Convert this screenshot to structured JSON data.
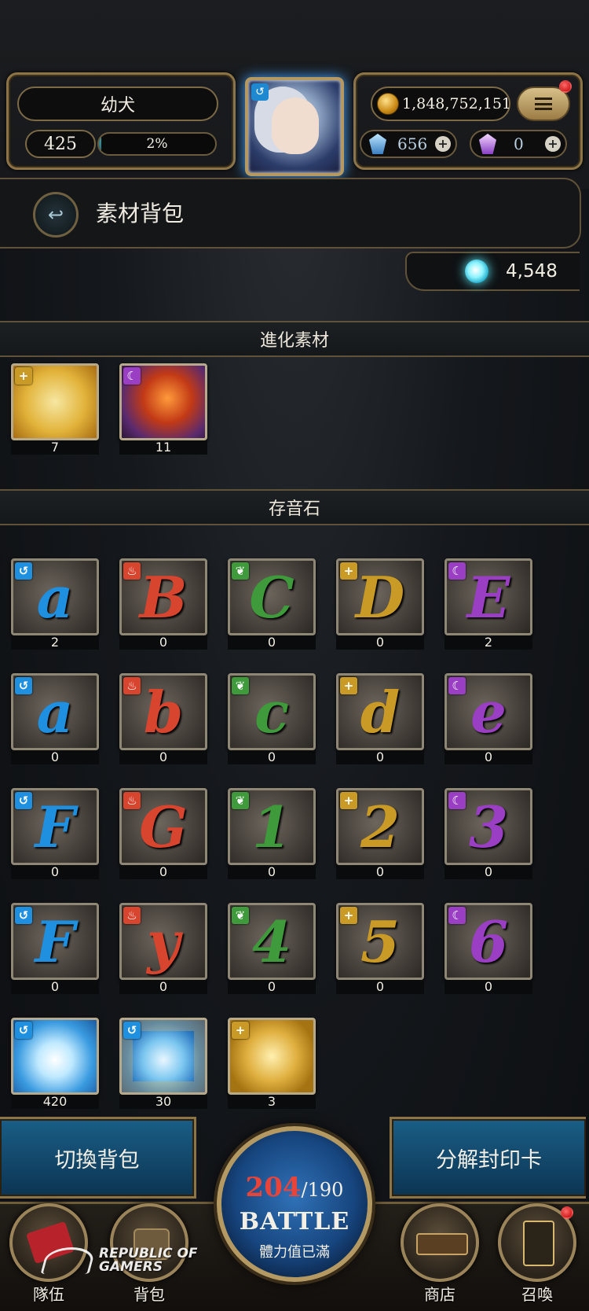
{
  "header": {
    "player_name": "幼犬",
    "level": "425",
    "exp_percent_text": "2%",
    "exp_fraction": 0.02,
    "gold": "1,848,752,151",
    "diamonds": "656",
    "crystals": "0"
  },
  "page": {
    "title": "素材背包",
    "soul_count": "4,548"
  },
  "sections": {
    "evolution": "進化素材",
    "music_stones": "存音石"
  },
  "evolution_items": [
    {
      "name": "golden-scroll",
      "attr": "light",
      "count": "7"
    },
    {
      "name": "shadow-bird",
      "attr": "dark",
      "count": "11"
    }
  ],
  "stones": [
    {
      "glyph": "a",
      "attr": "water",
      "count": "2"
    },
    {
      "glyph": "B",
      "attr": "fire",
      "count": "0"
    },
    {
      "glyph": "C",
      "attr": "wood",
      "count": "0"
    },
    {
      "glyph": "D",
      "attr": "light",
      "count": "0"
    },
    {
      "glyph": "E",
      "attr": "dark",
      "count": "2"
    },
    {
      "glyph": "a",
      "attr": "water",
      "count": "0"
    },
    {
      "glyph": "b",
      "attr": "fire",
      "count": "0"
    },
    {
      "glyph": "c",
      "attr": "wood",
      "count": "0"
    },
    {
      "glyph": "d",
      "attr": "light",
      "count": "0"
    },
    {
      "glyph": "e",
      "attr": "dark",
      "count": "0"
    },
    {
      "glyph": "F",
      "attr": "water",
      "count": "0"
    },
    {
      "glyph": "G",
      "attr": "fire",
      "count": "0"
    },
    {
      "glyph": "1",
      "attr": "wood",
      "count": "0"
    },
    {
      "glyph": "2",
      "attr": "light",
      "count": "0"
    },
    {
      "glyph": "3",
      "attr": "dark",
      "count": "0"
    },
    {
      "glyph": "F",
      "attr": "water",
      "count": "0"
    },
    {
      "glyph": "y",
      "attr": "fire",
      "count": "0"
    },
    {
      "glyph": "4",
      "attr": "wood",
      "count": "0"
    },
    {
      "glyph": "5",
      "attr": "light",
      "count": "0"
    },
    {
      "glyph": "6",
      "attr": "dark",
      "count": "0"
    }
  ],
  "special_items": [
    {
      "name": "blue-lantern",
      "attr": "water",
      "count": "420"
    },
    {
      "name": "blue-compass-lantern",
      "attr": "water",
      "count": "30"
    },
    {
      "name": "treble-clef-stone",
      "attr": "light",
      "count": "3"
    }
  ],
  "attr_colors": {
    "water": "#1f8fe0",
    "fire": "#d8452f",
    "wood": "#3e9a3a",
    "light": "#c99a25",
    "dark": "#9a3fc4"
  },
  "attr_symbols": {
    "water": "↺",
    "fire": "♨",
    "wood": "❦",
    "light": "+",
    "dark": "☾"
  },
  "buttons": {
    "switch_bag": "切換背包",
    "dismantle": "分解封印卡"
  },
  "battle": {
    "stamina_current": "204",
    "stamina_max": "/190",
    "label": "BATTLE",
    "status": "體力值已滿"
  },
  "nav": [
    {
      "id": "team",
      "label": "隊伍"
    },
    {
      "id": "bag",
      "label": "背包"
    },
    {
      "id": "shop",
      "label": "商店"
    },
    {
      "id": "summon",
      "label": "召喚"
    }
  ],
  "watermark": {
    "line1": "REPUBLIC OF",
    "line2": "GAMERS"
  }
}
